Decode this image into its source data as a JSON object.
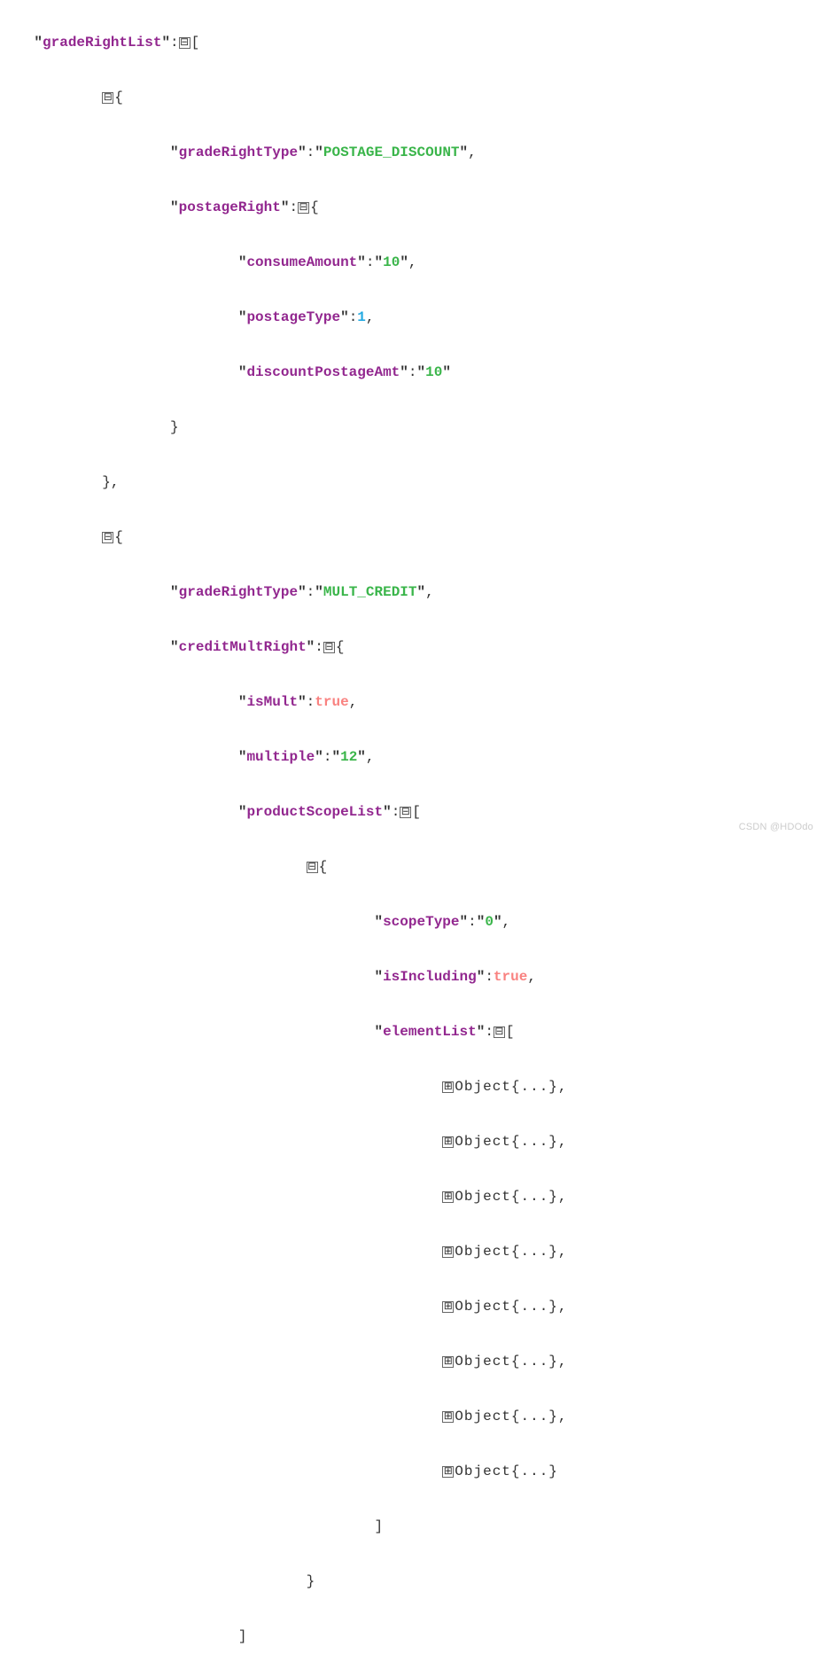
{
  "keys": {
    "gradeRightList": "gradeRightList",
    "gradeRightType": "gradeRightType",
    "postageRight": "postageRight",
    "consumeAmount": "consumeAmount",
    "postageType": "postageType",
    "discountPostageAmt": "discountPostageAmt",
    "creditMultRight": "creditMultRight",
    "isMult": "isMult",
    "multiple": "multiple",
    "productScopeList": "productScopeList",
    "scopeType": "scopeType",
    "isIncluding": "isIncluding",
    "elementList": "elementList"
  },
  "vals": {
    "postage_discount": "POSTAGE_DISCOUNT",
    "consumeAmount": "10",
    "postageType": "1",
    "discountPostageAmt": "10",
    "mult_credit": "MULT_CREDIT",
    "isMult": "true",
    "multiple": "12",
    "scopeType": "0",
    "isIncluding": "true",
    "objectCollapsed": "Object{...}"
  },
  "glyph": {
    "collapse": "⊟",
    "expand": "⊞"
  },
  "punct": {
    "q": "\"",
    "colon": ":",
    "comma": ",",
    "lbracket": "[",
    "rbracket": "]",
    "lbrace": "{",
    "rbrace": "}"
  },
  "watermark": "CSDN @HDOdo",
  "json_structure": {
    "gradeRightList": [
      {
        "gradeRightType": "POSTAGE_DISCOUNT",
        "postageRight": {
          "consumeAmount": "10",
          "postageType": 1,
          "discountPostageAmt": "10"
        }
      },
      {
        "gradeRightType": "MULT_CREDIT",
        "creditMultRight": {
          "isMult": true,
          "multiple": "12",
          "productScopeList": [
            {
              "scopeType": "0",
              "isIncluding": true,
              "elementList": [
                "Object{...}",
                "Object{...}",
                "Object{...}",
                "Object{...}",
                "Object{...}",
                "Object{...}",
                "Object{...}",
                "Object{...}"
              ]
            }
          ]
        }
      }
    ]
  }
}
